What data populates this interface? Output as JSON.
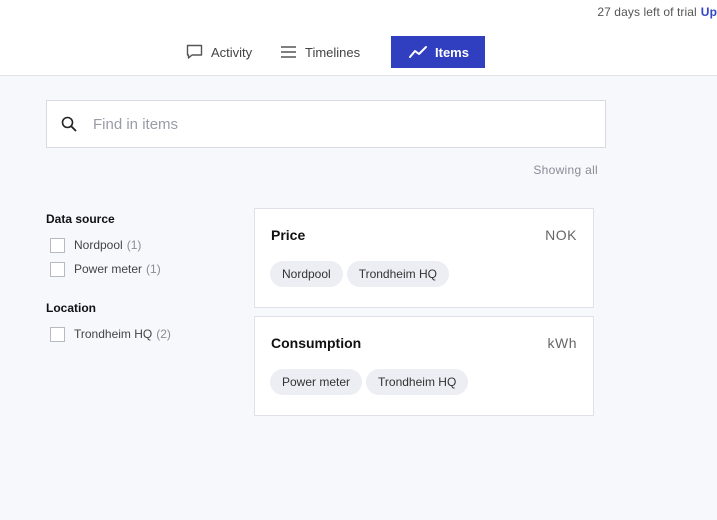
{
  "header": {
    "trial_text": "27 days left of trial",
    "upgrade_label": "Up"
  },
  "tabs": [
    {
      "label": "Activity",
      "icon": "speech-bubble-icon",
      "active": false
    },
    {
      "label": "Timelines",
      "icon": "menu-lines-icon",
      "active": false
    },
    {
      "label": "Items",
      "icon": "line-chart-icon",
      "active": true
    }
  ],
  "search": {
    "placeholder": "Find in items",
    "value": ""
  },
  "status": {
    "showing": "Showing all"
  },
  "filters": [
    {
      "title": "Data source",
      "options": [
        {
          "label": "Nordpool",
          "count": "(1)",
          "checked": false
        },
        {
          "label": "Power meter",
          "count": "(1)",
          "checked": false
        }
      ]
    },
    {
      "title": "Location",
      "options": [
        {
          "label": "Trondheim HQ",
          "count": "(2)",
          "checked": false
        }
      ]
    }
  ],
  "items": [
    {
      "title": "Price",
      "unit": "NOK",
      "tags": [
        "Nordpool",
        "Trondheim HQ"
      ]
    },
    {
      "title": "Consumption",
      "unit": "kWh",
      "tags": [
        "Power meter",
        "Trondheim HQ"
      ]
    }
  ],
  "colors": {
    "accent": "#2f3fbf",
    "background": "#f7f8fc",
    "chip": "#eceef4"
  }
}
